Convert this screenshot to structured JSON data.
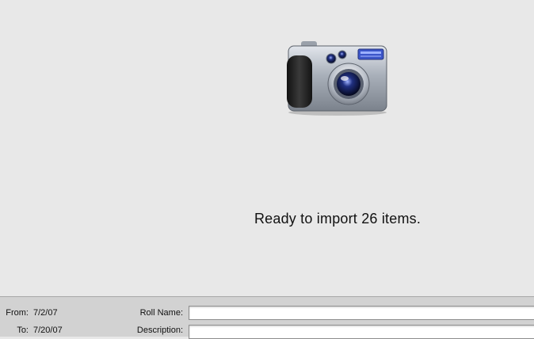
{
  "status": {
    "message": "Ready to import 26 items."
  },
  "camera": {
    "icon": "digital-camera-icon"
  },
  "import_info": {
    "from_label": "From:",
    "from_value": "7/2/07",
    "to_label": "To:",
    "to_value": "7/20/07",
    "roll_name_label": "Roll Name:",
    "roll_name_value": "",
    "description_label": "Description:",
    "description_value": ""
  }
}
